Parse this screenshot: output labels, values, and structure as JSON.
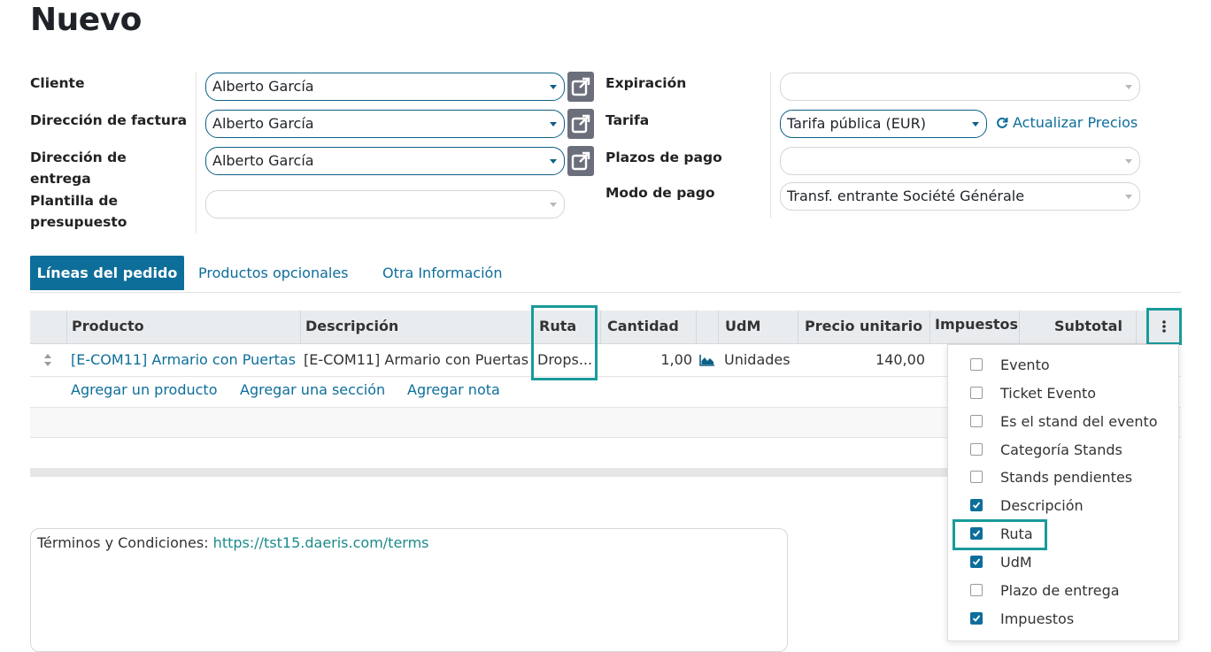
{
  "page": {
    "title": "Nuevo"
  },
  "form": {
    "left": [
      {
        "label": "Cliente",
        "value": "Alberto García"
      },
      {
        "label": "Dirección de factura",
        "value": "Alberto García"
      },
      {
        "label_line1": "Dirección de",
        "label_line2": "entrega",
        "value": "Alberto García"
      },
      {
        "label_line1": "Plantilla de",
        "label_line2": "presupuesto",
        "value": ""
      }
    ],
    "right": [
      {
        "label": "Expiración",
        "value": ""
      },
      {
        "label": "Tarifa",
        "value": "Tarifa pública (EUR)",
        "action": "Actualizar Precios"
      },
      {
        "label": "Plazos de pago",
        "value": ""
      },
      {
        "label": "Modo de pago",
        "value": "Transf. entrante Société Générale"
      }
    ]
  },
  "tabs": [
    "Líneas del pedido",
    "Productos opcionales",
    "Otra Información"
  ],
  "table": {
    "headers": [
      "Producto",
      "Descripción",
      "Ruta",
      "Cantidad",
      "UdM",
      "Precio unitario",
      "Impuestos",
      "Subtotal"
    ],
    "row": {
      "producto": "[E-COM11] Armario con Puertas",
      "descripcion": "[E-COM11] Armario con Puertas",
      "ruta": "Drops...",
      "cantidad": "1,00",
      "udm": "Unidades",
      "precio": "140,00"
    },
    "add_links": [
      "Agregar un producto",
      "Agregar una sección",
      "Agregar nota"
    ]
  },
  "column_menu": {
    "options": [
      {
        "label": "Evento",
        "checked": false
      },
      {
        "label": "Ticket Evento",
        "checked": false
      },
      {
        "label": "Es el stand del evento",
        "checked": false
      },
      {
        "label": "Categoría Stands",
        "checked": false
      },
      {
        "label": "Stands pendientes",
        "checked": false
      },
      {
        "label": "Descripción",
        "checked": true
      },
      {
        "label": "Ruta",
        "checked": true
      },
      {
        "label": "UdM",
        "checked": true
      },
      {
        "label": "Plazo de entrega",
        "checked": false
      },
      {
        "label": "Impuestos",
        "checked": true
      }
    ]
  },
  "terms": {
    "prefix": "Términos y Condiciones: ",
    "url": "https://tst15.daeris.com/terms"
  },
  "colors": {
    "accent": "#0e6e9a",
    "highlight": "#1a9a9a",
    "external_button": "#6b6f7b"
  }
}
